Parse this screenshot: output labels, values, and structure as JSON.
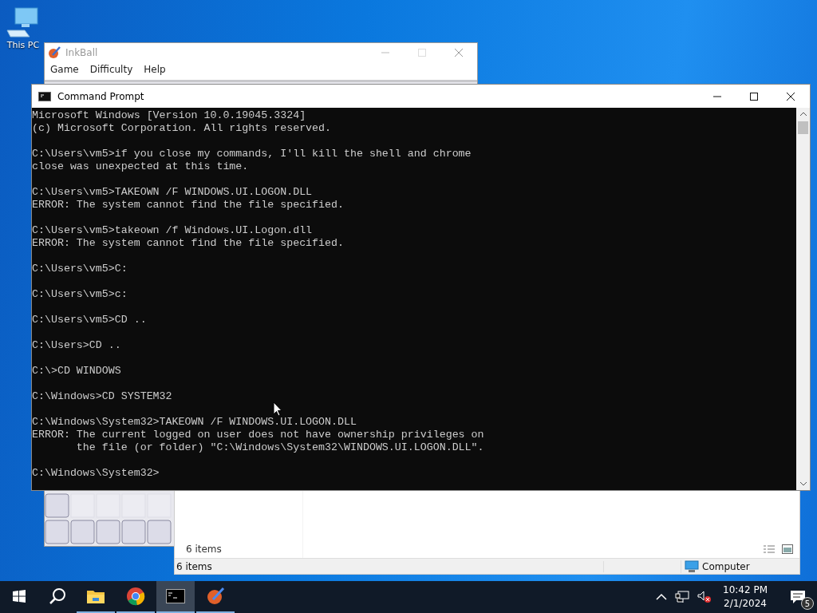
{
  "desktop_icons": [
    {
      "label": "This PC"
    }
  ],
  "inkball": {
    "title": "InkBall",
    "menu": [
      "Game",
      "Difficulty",
      "Help"
    ]
  },
  "explorer": {
    "content_status": "6 items",
    "status_bar": [
      "6 items",
      "Computer"
    ]
  },
  "command_prompt": {
    "title": "Command Prompt",
    "blocks": [
      [
        "Microsoft Windows [Version 10.0.19045.3324]",
        "(c) Microsoft Corporation. All rights reserved."
      ],
      [
        "C:\\Users\\vm5>if you close my commands, I'll kill the shell and chrome",
        "close was unexpected at this time."
      ],
      [
        "C:\\Users\\vm5>TAKEOWN /F WINDOWS.UI.LOGON.DLL",
        "ERROR: The system cannot find the file specified."
      ],
      [
        "C:\\Users\\vm5>takeown /f Windows.UI.Logon.dll",
        "ERROR: The system cannot find the file specified."
      ],
      [
        "C:\\Users\\vm5>C:"
      ],
      [
        "C:\\Users\\vm5>c:"
      ],
      [
        "C:\\Users\\vm5>CD .."
      ],
      [
        "C:\\Users>CD .."
      ],
      [
        "C:\\>CD WINDOWS"
      ],
      [
        "C:\\Windows>CD SYSTEM32"
      ],
      [
        "C:\\Windows\\System32>TAKEOWN /F WINDOWS.UI.LOGON.DLL",
        "ERROR: The current logged on user does not have ownership privileges on",
        "       the file (or folder) \"C:\\Windows\\System32\\WINDOWS.UI.LOGON.DLL\"."
      ],
      [
        "C:\\Windows\\System32>"
      ]
    ]
  },
  "taskbar": {
    "items": [
      {
        "kind": "start",
        "selected": false
      },
      {
        "kind": "search",
        "selected": false
      },
      {
        "kind": "explorer",
        "selected": false
      },
      {
        "kind": "chrome",
        "selected": false
      },
      {
        "kind": "terminal",
        "selected": true
      },
      {
        "kind": "inkball",
        "selected": false
      }
    ],
    "time": "10:42 PM",
    "date": "2/1/2024",
    "notification_count": "5"
  }
}
